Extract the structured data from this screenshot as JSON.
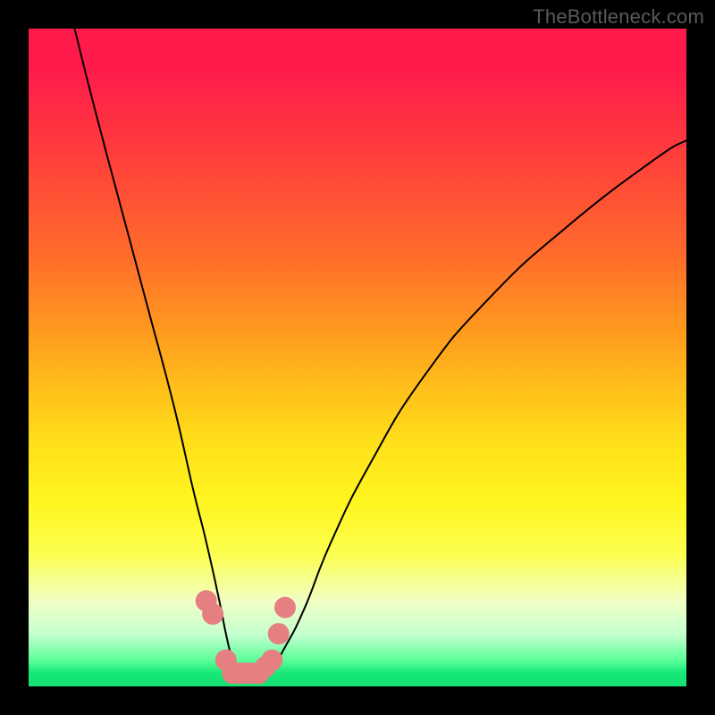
{
  "watermark_text": "TheBottleneck.com",
  "chart_data": {
    "type": "line",
    "title": "",
    "xlabel": "",
    "ylabel": "",
    "ylim": [
      0,
      100
    ],
    "xlim": [
      0,
      100
    ],
    "series": [
      {
        "name": "bottleneck-curve",
        "x": [
          7,
          10,
          14,
          18,
          22,
          25,
          27,
          29,
          30,
          31,
          32,
          33,
          35,
          37,
          39,
          42,
          46,
          52,
          60,
          70,
          82,
          95,
          100
        ],
        "values": [
          100,
          88,
          73,
          58,
          43,
          30,
          22,
          13,
          8,
          4,
          2,
          2,
          2,
          3,
          6,
          12,
          22,
          34,
          47,
          59,
          70,
          80,
          83
        ]
      }
    ],
    "markers": {
      "name": "highlight-region",
      "color": "#e67f82",
      "points": [
        {
          "x": 27,
          "y": 13
        },
        {
          "x": 28,
          "y": 11
        },
        {
          "x": 30,
          "y": 4
        },
        {
          "x": 31,
          "y": 2
        },
        {
          "x": 32,
          "y": 2
        },
        {
          "x": 33,
          "y": 2
        },
        {
          "x": 34,
          "y": 2
        },
        {
          "x": 35,
          "y": 2
        },
        {
          "x": 36,
          "y": 3
        },
        {
          "x": 37,
          "y": 4
        },
        {
          "x": 38,
          "y": 8
        },
        {
          "x": 39,
          "y": 12
        }
      ]
    }
  }
}
